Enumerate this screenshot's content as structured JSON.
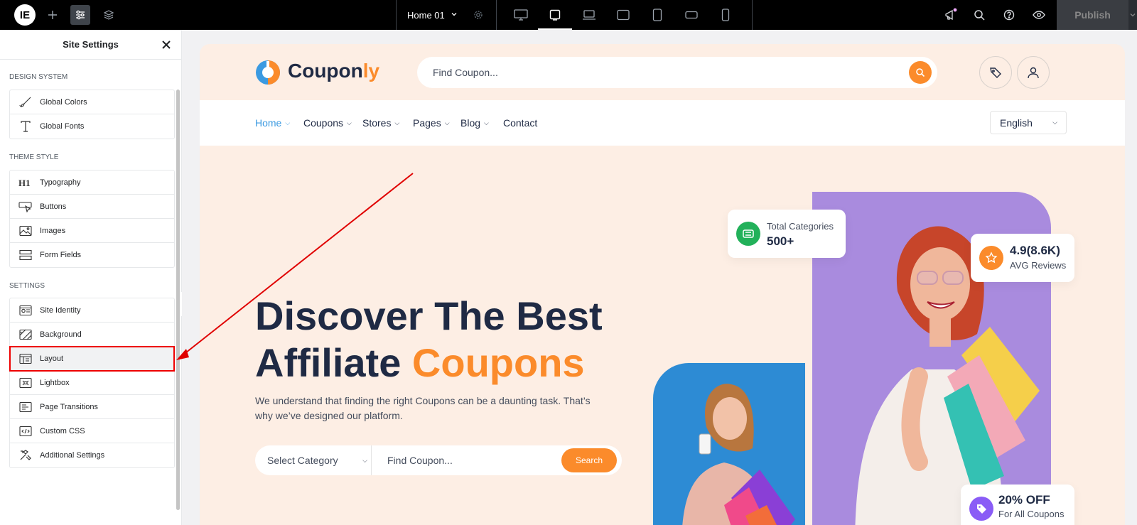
{
  "topbar": {
    "logo_glyph": "IE",
    "page_name": "Home 01",
    "publish_label": "Publish",
    "icons": [
      "elementor-logo-icon",
      "plus-icon",
      "sliders-icon",
      "layers-icon",
      "chevron-down-icon",
      "gear-icon",
      "desktop-icon",
      "tablet-landscape-icon",
      "laptop-icon",
      "tablet-icon",
      "tablet-portrait-icon",
      "mobile-landscape-icon",
      "mobile-icon",
      "megaphone-icon",
      "search-icon",
      "help-icon",
      "eye-icon"
    ]
  },
  "panel": {
    "title": "Site Settings",
    "sections": {
      "design_system": {
        "label": "DESIGN SYSTEM",
        "items": [
          {
            "label": "Global Colors",
            "icon": "brush-icon"
          },
          {
            "label": "Global Fonts",
            "icon": "font-icon"
          }
        ]
      },
      "theme_style": {
        "label": "THEME STYLE",
        "items": [
          {
            "label": "Typography",
            "icon": "h1-icon"
          },
          {
            "label": "Buttons",
            "icon": "button-icon"
          },
          {
            "label": "Images",
            "icon": "image-icon"
          },
          {
            "label": "Form Fields",
            "icon": "form-icon"
          }
        ]
      },
      "settings": {
        "label": "SETTINGS",
        "items": [
          {
            "label": "Site Identity",
            "icon": "id-card-icon"
          },
          {
            "label": "Background",
            "icon": "background-icon"
          },
          {
            "label": "Layout",
            "icon": "layout-icon"
          },
          {
            "label": "Lightbox",
            "icon": "lightbox-icon"
          },
          {
            "label": "Page Transitions",
            "icon": "transition-icon"
          },
          {
            "label": "Custom CSS",
            "icon": "code-icon"
          },
          {
            "label": "Additional Settings",
            "icon": "tools-icon"
          }
        ]
      }
    }
  },
  "site": {
    "brand_a": "Coupon",
    "brand_b": "ly",
    "header_search_placeholder": "Find Coupon...",
    "nav": [
      {
        "label": "Home"
      },
      {
        "label": "Coupons"
      },
      {
        "label": "Stores"
      },
      {
        "label": "Pages"
      },
      {
        "label": "Blog"
      },
      {
        "label": "Contact"
      }
    ],
    "language": "English",
    "hero": {
      "title_line1": "Discover The Best",
      "title_line2a": "Affiliate ",
      "title_line2b": "Coupons",
      "lead": "We understand that finding the right Coupons can be a daunting task. That’s why we’ve designed our platform.",
      "category_select": "Select Category",
      "search_placeholder": "Find Coupon...",
      "search_button": "Search"
    },
    "stats": {
      "categories_label": "Total Categories",
      "categories_value": "500+",
      "rating_value": "4.9(8.6K)",
      "rating_label": "AVG Reviews",
      "off_value": "20% OFF",
      "off_label": "For All Coupons"
    }
  },
  "colors": {
    "accent_orange": "#fb8b2b",
    "hero_bg": "#fdeee4",
    "purple_card": "#a98bde",
    "blue_card": "#2d8bd4",
    "nav_active": "#3b9ae1",
    "annotation_red": "#e00000"
  }
}
